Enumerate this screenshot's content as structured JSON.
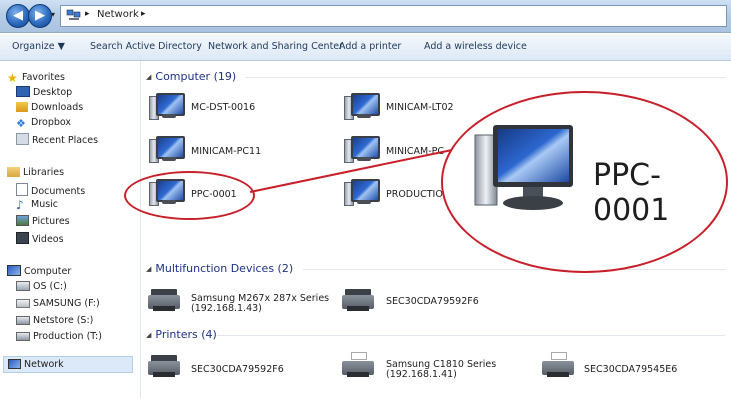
{
  "window": {
    "breadcrumb": "Network",
    "breadcrumb_sep": "▸",
    "back_glyph": "◀",
    "forward_glyph": "▶",
    "history_glyph": "▾"
  },
  "toolbar": {
    "organize": "Organize ▼",
    "search_ad": "Search Active Directory",
    "nsc": "Network and Sharing Center",
    "add_printer": "Add a printer",
    "add_wireless": "Add a wireless device"
  },
  "nav": {
    "favorites": "Favorites",
    "desktop": "Desktop",
    "downloads": "Downloads",
    "dropbox": "Dropbox",
    "recent": "Recent Places",
    "libraries": "Libraries",
    "documents": "Documents",
    "music": "Music",
    "pictures": "Pictures",
    "videos": "Videos",
    "computer": "Computer",
    "os": "OS (C:)",
    "samsung": "SAMSUNG (F:)",
    "netstore": "Netstore (S:)",
    "production": "Production (T:)",
    "network": "Network"
  },
  "groups": {
    "computer": "Computer (19)",
    "mfd": "Multifunction Devices (2)",
    "printers": "Printers (4)"
  },
  "computers": [
    "MC-DST-0016",
    "MINICAM-LT02",
    "MINICAM-PC11",
    "MINICAM-PC",
    "PPC-0001",
    "PRODUCTION"
  ],
  "mfd": {
    "d1_line1": "Samsung M267x 287x Series",
    "d1_line2": "(192.168.1.43)",
    "d2": "SEC30CDA79592F6"
  },
  "printers": {
    "p1": "SEC30CDA79592F6",
    "p2_line1": "Samsung C1810 Series",
    "p2_line2": "(192.168.1.41)",
    "p3": "SEC30CDA79545E6"
  },
  "callout": {
    "label": "PPC-0001",
    "color": "#c8202a"
  },
  "icons": {
    "back": "back-arrow-icon",
    "forward": "forward-arrow-icon",
    "network": "network-icon",
    "computer": "monitor-icon",
    "printer": "printer-icon",
    "favorites": "star-icon"
  }
}
